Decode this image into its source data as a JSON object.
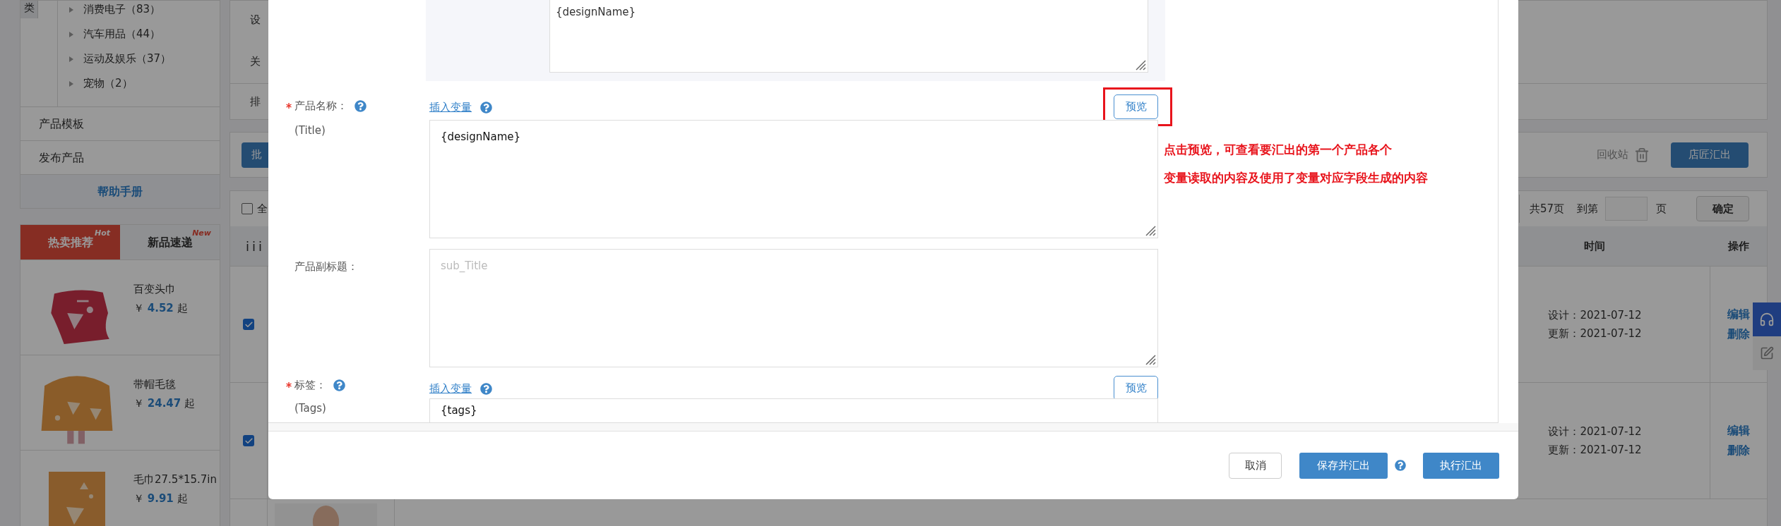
{
  "sidebar": {
    "category_tab": "类",
    "categories": [
      {
        "label": "消费电子（83）",
        "expanded": false
      },
      {
        "label": "汽车用品（44）",
        "expanded": false
      },
      {
        "label": "运动及娱乐（37）",
        "expanded": false
      },
      {
        "label": "宠物（2）",
        "expanded": false
      }
    ],
    "menu": [
      "产品模板",
      "发布产品"
    ],
    "help_link": "帮助手册",
    "promo_tabs": [
      {
        "label": "热卖推荐",
        "badge": "Hot",
        "selected": true
      },
      {
        "label": "新品速递",
        "badge": "New",
        "selected": false
      }
    ],
    "products": [
      {
        "name": "百变头巾",
        "currency": "￥",
        "price": "4.52",
        "suffix": "起"
      },
      {
        "name": "带帽毛毯",
        "currency": "￥",
        "price": "24.47",
        "suffix": "起"
      },
      {
        "name": "毛巾27.5*15.7in",
        "currency": "￥",
        "price": "9.91",
        "suffix": "起"
      }
    ]
  },
  "main": {
    "filter_labels": [
      "设",
      "关"
    ],
    "sort_label": "排",
    "batch_button": "批",
    "toolbar": {
      "recycle_bin": "回收站",
      "export_button": "店匠汇出"
    },
    "select_all": {
      "label": "全",
      "checked": false
    },
    "pagination": {
      "total": "共57页",
      "goto": "到第",
      "unit": "页",
      "confirm": "确定"
    },
    "table": {
      "columns": [
        "iii",
        "时间",
        "操作"
      ],
      "rows": [
        {
          "kind": "full",
          "selected": true,
          "designed": "设计：2021-07-12",
          "updated": "更新：2021-07-12",
          "actions": [
            "编辑",
            "删除"
          ]
        },
        {
          "kind": "full",
          "selected": true,
          "designed": "设计：2021-07-12",
          "updated": "更新：2021-07-12",
          "actions": [
            "编辑",
            "删除"
          ]
        },
        {
          "kind": "partial"
        }
      ]
    }
  },
  "dialog": {
    "top_field": {
      "value": "{designName}"
    },
    "fields": [
      {
        "label": "产品名称：",
        "sublabel": "(Title)",
        "required": true,
        "help": true,
        "insert_link": "插入变量",
        "preview_button": "预览",
        "highlighted": true,
        "value": "{designName}"
      },
      {
        "label": "产品副标题：",
        "required": false,
        "help": false,
        "placeholder": "sub_Title"
      },
      {
        "label": "标签：",
        "sublabel": "(Tags)",
        "required": true,
        "help": true,
        "insert_link": "插入变量",
        "preview_button": "预览",
        "highlighted": false,
        "value": "{tags}"
      }
    ],
    "annotation": [
      "点击预览，可查看要汇出的第一个产品各个",
      "变量读取的内容及使用了变量对应字段生成的内容"
    ],
    "footer": {
      "cancel": "取消",
      "save_export": "保存并汇出",
      "save_help": true,
      "execute": "执行汇出"
    }
  }
}
